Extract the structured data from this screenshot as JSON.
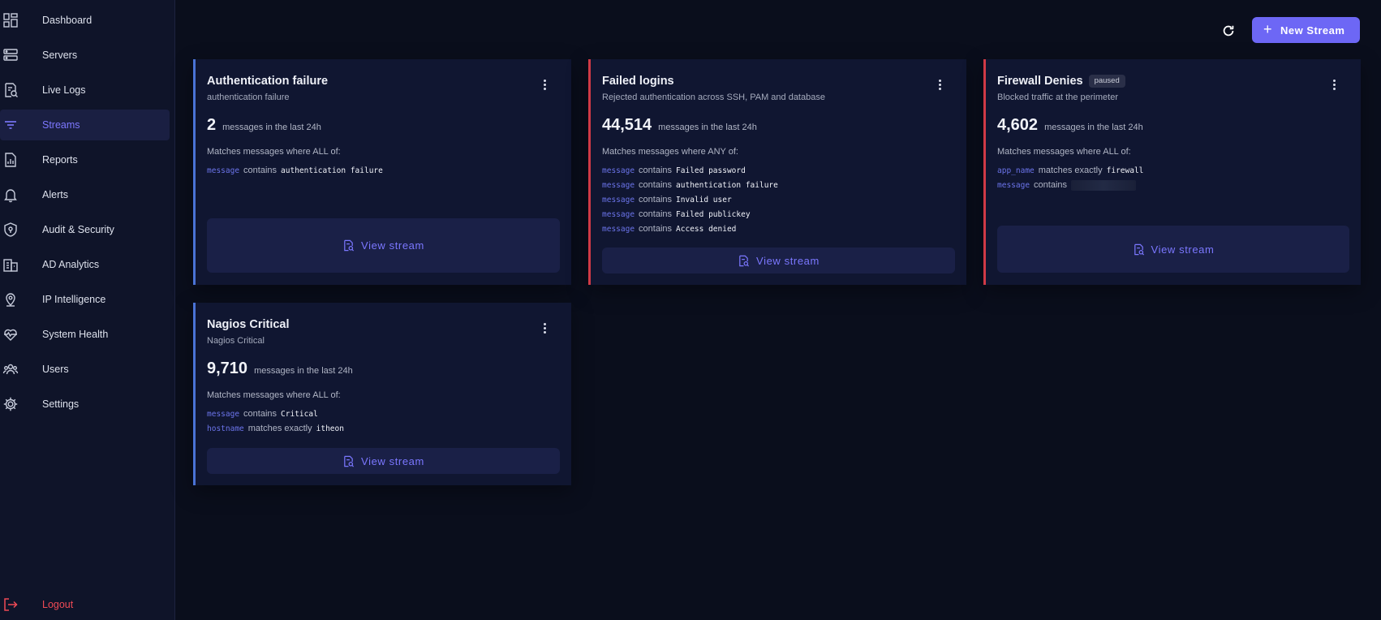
{
  "sidebar": {
    "items": [
      {
        "label": "Dashboard",
        "icon": "dashboard-icon"
      },
      {
        "label": "Servers",
        "icon": "server-icon"
      },
      {
        "label": "Live Logs",
        "icon": "live-logs-icon"
      },
      {
        "label": "Streams",
        "icon": "filter-icon",
        "active": true
      },
      {
        "label": "Reports",
        "icon": "report-icon"
      },
      {
        "label": "Alerts",
        "icon": "bell-icon"
      },
      {
        "label": "Audit & Security",
        "icon": "shield-icon"
      },
      {
        "label": "AD Analytics",
        "icon": "building-icon"
      },
      {
        "label": "IP Intelligence",
        "icon": "map-pin-icon"
      },
      {
        "label": "System Health",
        "icon": "heartbeat-icon"
      },
      {
        "label": "Users",
        "icon": "users-icon"
      },
      {
        "label": "Settings",
        "icon": "gear-icon"
      }
    ],
    "logout_label": "Logout"
  },
  "header": {
    "new_stream_label": "New Stream",
    "refresh_icon": "refresh-icon",
    "plus_icon": "+"
  },
  "colors": {
    "accent": "#6d67f5",
    "active_stream_border": "#4a73d6",
    "alert_stream_border": "#d03a46",
    "logout": "#ef4a55"
  },
  "streams": [
    {
      "title": "Authentication failure",
      "subtitle": "authentication failure",
      "count": "2",
      "count_suffix": "messages in the last 24h",
      "match_header": "Matches messages where ALL of:",
      "rules": [
        {
          "field": "message",
          "op": "contains",
          "value": "authentication failure"
        }
      ],
      "view_label": "View stream"
    },
    {
      "title": "Failed logins",
      "subtitle": "Rejected authentication across SSH, PAM and database",
      "count": "44,514",
      "count_suffix": "messages in the last 24h",
      "match_header": "Matches messages where ANY of:",
      "rules": [
        {
          "field": "message",
          "op": "contains",
          "value": "Failed password"
        },
        {
          "field": "message",
          "op": "contains",
          "value": "authentication failure"
        },
        {
          "field": "message",
          "op": "contains",
          "value": "Invalid user"
        },
        {
          "field": "message",
          "op": "contains",
          "value": "Failed publickey"
        },
        {
          "field": "message",
          "op": "contains",
          "value": "Access denied"
        }
      ],
      "view_label": "View stream"
    },
    {
      "title": "Firewall Denies",
      "badge": "paused",
      "subtitle": "Blocked traffic at the perimeter",
      "count": "4,602",
      "count_suffix": "messages in the last 24h",
      "match_header": "Matches messages where ALL of:",
      "rules": [
        {
          "field": "app_name",
          "op": "matches exactly",
          "value": "firewall"
        },
        {
          "field": "message",
          "op": "contains",
          "value": ""
        }
      ],
      "view_label": "View stream"
    },
    {
      "title": "Nagios Critical",
      "subtitle": "Nagios Critical",
      "count": "9,710",
      "count_suffix": "messages in the last 24h",
      "match_header": "Matches messages where ALL of:",
      "rules": [
        {
          "field": "message",
          "op": "contains",
          "value": "Critical"
        },
        {
          "field": "hostname",
          "op": "matches exactly",
          "value": "itheon"
        }
      ],
      "view_label": "View stream"
    }
  ]
}
